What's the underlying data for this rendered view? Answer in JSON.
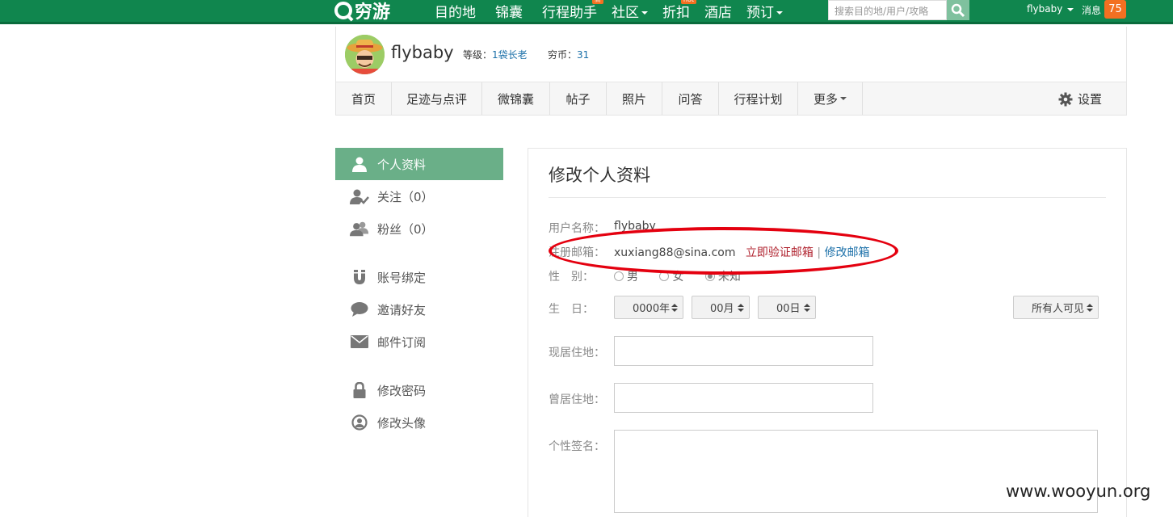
{
  "topbar": {
    "logo": "穷游",
    "nav": [
      {
        "label": "目的地"
      },
      {
        "label": "锦囊"
      },
      {
        "label": "行程助手",
        "tag": "新"
      },
      {
        "label": "社区",
        "caret": true
      },
      {
        "label": "折扣",
        "tag": "hot"
      },
      {
        "label": "酒店"
      },
      {
        "label": "预订",
        "caret": true
      }
    ],
    "search_placeholder": "搜索目的地/用户/攻略",
    "username": "flybaby",
    "messages_label": "消息",
    "messages_count": "75"
  },
  "profile": {
    "username": "flybaby",
    "level_label": "等级：",
    "level_value": "1袋长老",
    "coins_label": "穷币：",
    "coins_value": "31",
    "tabs": [
      "首页",
      "足迹与点评",
      "微锦囊",
      "帖子",
      "照片",
      "问答",
      "行程计划",
      "更多"
    ],
    "settings_label": "设置"
  },
  "sidebar": {
    "items": [
      {
        "label": "个人资料",
        "icon": "user-icon"
      },
      {
        "label": "关注（0）",
        "icon": "user-check-icon"
      },
      {
        "label": "粉丝（0）",
        "icon": "users-icon"
      },
      {
        "label": "账号绑定",
        "icon": "magnet-icon"
      },
      {
        "label": "邀请好友",
        "icon": "speech-bubble-icon"
      },
      {
        "label": "邮件订阅",
        "icon": "envelope-icon"
      },
      {
        "label": "修改密码",
        "icon": "lock-icon"
      },
      {
        "label": "修改头像",
        "icon": "avatar-icon"
      }
    ]
  },
  "form": {
    "title": "修改个人资料",
    "username_label": "用户名称：",
    "username_value": "flybaby",
    "email_label": "注册邮箱：",
    "email_value": "xuxiang88@sina.com",
    "verify_link": "立即验证邮箱",
    "separator": "|",
    "change_email_link": "修改邮箱",
    "gender_label": "性　别：",
    "gender_options": [
      "男",
      "女",
      "未知"
    ],
    "gender_selected": "未知",
    "birthday_label": "生　日：",
    "year": "0000年",
    "month": "00月",
    "day": "00日",
    "visibility": "所有人可见",
    "current_residence_label": "现居住地：",
    "former_residence_label": "曾居住地：",
    "signature_label": "个性签名："
  },
  "colors": {
    "brand_green": "#10864e",
    "active_green": "#6aaf88",
    "accent_orange": "#f37021",
    "annotation_red": "#e4000f"
  },
  "watermark": "www.wooyun.org"
}
